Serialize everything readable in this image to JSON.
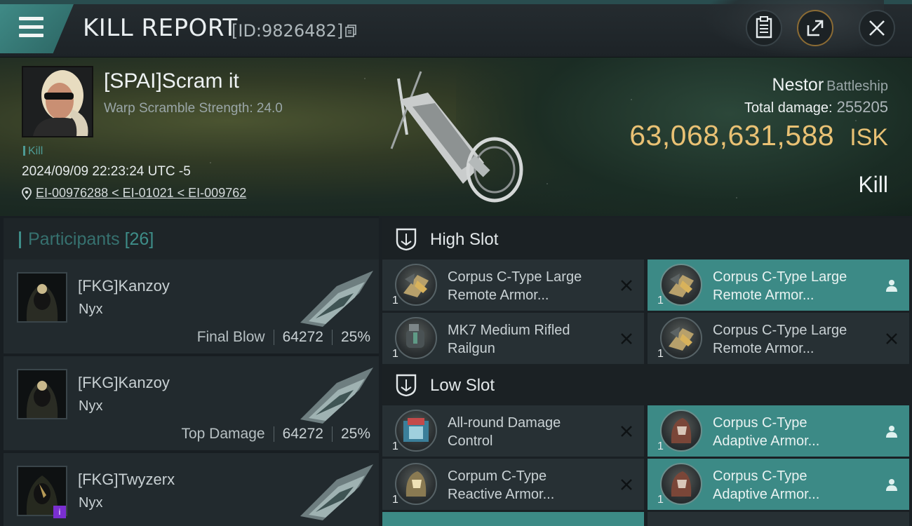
{
  "header": {
    "title": "KILL REPORT",
    "report_id": "[ID:9826482]"
  },
  "victim": {
    "name": "[SPAI]Scram it",
    "subtitle": "Warp Scramble Strength: 24.0",
    "tag": "Kill",
    "timestamp": "2024/09/09 22:23:24 UTC -5",
    "location": "EI-00976288 < EI-01021 < EI-009762",
    "ship_name": "Nestor",
    "ship_class": "Battleship",
    "total_damage_label": "Total damage:",
    "total_damage": "255205",
    "isk_value": "63,068,631,588",
    "isk_unit": "ISK",
    "status": "Kill"
  },
  "participants": {
    "label": "Participants",
    "count": "[26]",
    "items": [
      {
        "name": "[FKG]Kanzoy",
        "ship": "Nyx",
        "role": "Final Blow",
        "damage": "64272",
        "percent": "25%"
      },
      {
        "name": "[FKG]Kanzoy",
        "ship": "Nyx",
        "role": "Top Damage",
        "damage": "64272",
        "percent": "25%"
      },
      {
        "name": "[FKG]Twyzerx",
        "ship": "Nyx",
        "role": "",
        "damage": "",
        "percent": "",
        "badge": "i"
      }
    ]
  },
  "fitting": {
    "high_slot_label": "High Slot",
    "low_slot_label": "Low Slot",
    "high": [
      {
        "name_line1": "Corpus C-Type Large",
        "name_line2": "Remote Armor...",
        "qty": "1",
        "state": "destroyed"
      },
      {
        "name_line1": "Corpus C-Type Large",
        "name_line2": "Remote Armor...",
        "qty": "1",
        "state": "dropped"
      },
      {
        "name_line1": "MK7 Medium Rifled",
        "name_line2": "Railgun",
        "qty": "1",
        "state": "destroyed"
      },
      {
        "name_line1": "Corpus C-Type Large",
        "name_line2": "Remote Armor...",
        "qty": "1",
        "state": "destroyed"
      }
    ],
    "low": [
      {
        "name_line1": "All-round Damage",
        "name_line2": "Control",
        "qty": "1",
        "state": "destroyed"
      },
      {
        "name_line1": "Corpus C-Type",
        "name_line2": "Adaptive Armor...",
        "qty": "1",
        "state": "dropped"
      },
      {
        "name_line1": "Corpum C-Type",
        "name_line2": "Reactive Armor...",
        "qty": "1",
        "state": "destroyed"
      },
      {
        "name_line1": "Corpus C-Type",
        "name_line2": "Adaptive Armor...",
        "qty": "1",
        "state": "dropped"
      }
    ]
  },
  "icons": {
    "menu": "hamburger-menu-icon",
    "copy": "copy-icon",
    "clipboard": "clipboard-icon",
    "share": "share-icon",
    "close": "close-icon",
    "location": "location-pin-icon",
    "slot": "slot-shield-icon",
    "destroyed": "x-icon",
    "dropped": "person-icon"
  },
  "colors": {
    "accent_teal": "#3c8a86",
    "isk_gold": "#e9c174",
    "panel_dark": "#222a2e"
  }
}
